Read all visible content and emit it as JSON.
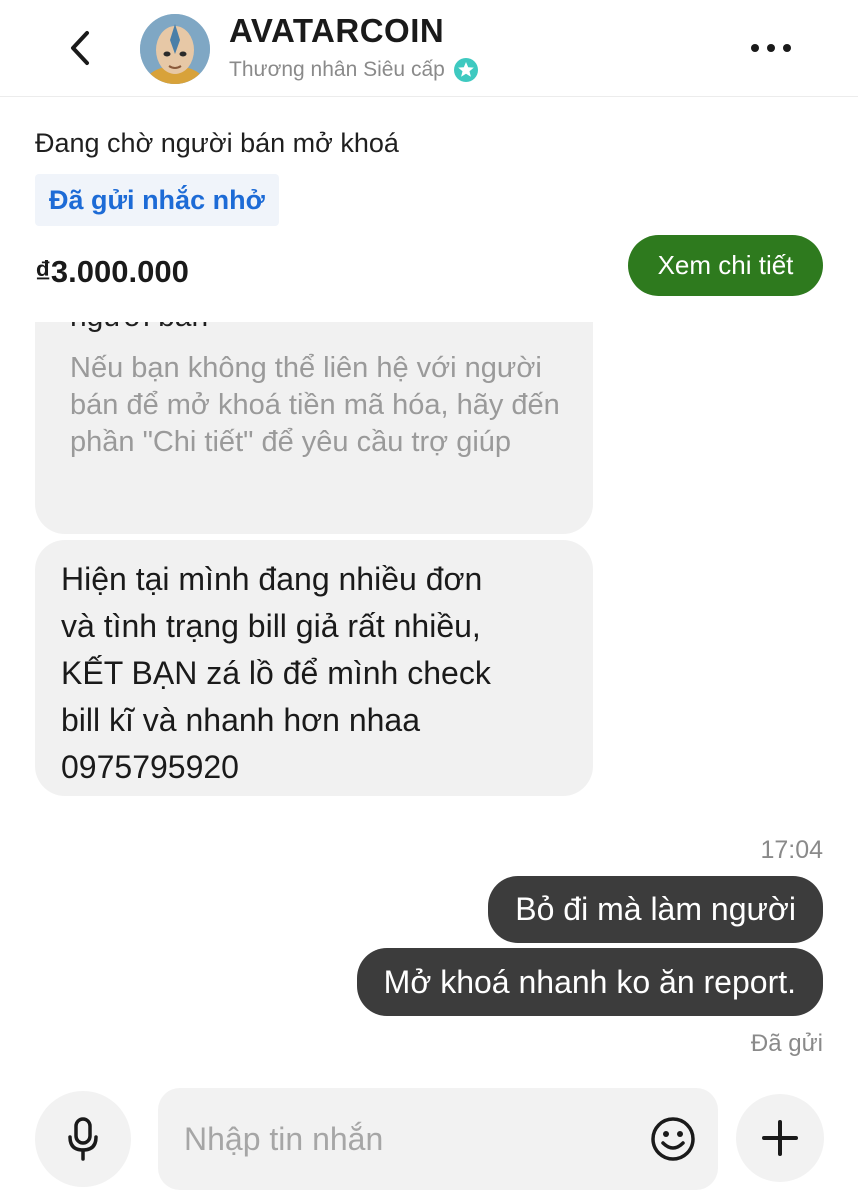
{
  "header": {
    "contact_name": "AVATARCOIN",
    "contact_rank": "Thương nhân Siêu cấp",
    "back_icon": "chevron-left-icon",
    "more_icon": "more-horizontal-icon",
    "badge_icon": "verified-star-icon"
  },
  "order": {
    "status": "Đang chờ người bán mở khoá",
    "reminder_label": "Đã gửi nhắc nhở",
    "price": "₫3.000.000",
    "detail_button": "Xem chi tiết"
  },
  "messages": {
    "system_cut_line": "người bán",
    "system_hint": "Nếu bạn không thể liên hệ với người bán để mở khoá tiền mã hóa, hãy đến phần \"Chi tiết\" để yêu cầu trợ giúp",
    "seller_message": "Hiện tại mình đang nhiều đơn\nvà tình trạng bill giả rất nhiều,\nKẾT BẠN zá lồ để mình check\nbill kĩ và nhanh hơn nhaa\n0975795920",
    "time": "17:04",
    "outgoing": [
      "Bỏ đi mà làm người",
      "Mở khoá nhanh ko ăn report."
    ],
    "sent_status": "Đã gửi"
  },
  "composer": {
    "placeholder": "Nhập tin nhắn",
    "mic_icon": "microphone-icon",
    "emoji_icon": "smiley-icon",
    "plus_icon": "plus-icon"
  },
  "colors": {
    "accent_green": "#2e7a1e",
    "link_blue": "#1d6bd6",
    "outgoing_bubble": "#3c3c3c",
    "incoming_bubble": "#f1f1f1",
    "badge_teal": "#3ec9c0"
  }
}
